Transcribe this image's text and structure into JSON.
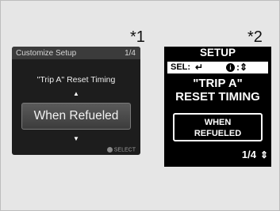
{
  "figure": {
    "markers": [
      "*1",
      "*2"
    ]
  },
  "screen_a": {
    "title": "Customize Setup",
    "page": "1/4",
    "setting": "\"Trip A\" Reset Timing",
    "up_arrow": "▲",
    "option": "When Refueled",
    "down_arrow": "▼",
    "hint": "SELECT",
    "colors": {
      "background": "#1d1d1d",
      "titlebar": "#3b3b3b",
      "option_fill": "#4a4a4a"
    }
  },
  "screen_b": {
    "title": "SETUP",
    "sel_label": "SEL:",
    "sel_glyph": "↵",
    "info_icon": "i",
    "info_glyph": ":⇕",
    "setting_line1": "\"TRIP A\"",
    "setting_line2": "RESET TIMING",
    "option_line1": "WHEN",
    "option_line2": "REFUELED",
    "page": "1/4",
    "page_glyph": "⇕",
    "colors": {
      "background": "#000000",
      "foreground": "#ffffff"
    }
  }
}
